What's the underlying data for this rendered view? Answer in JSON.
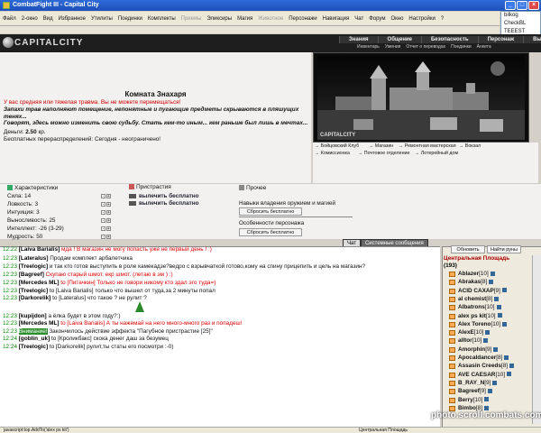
{
  "window": {
    "title": "CombatFight III - Capital City"
  },
  "menu": [
    "Файл",
    "2-окно",
    "Вид",
    "Избранное",
    "Утилиты",
    "Поединки",
    "Комплекты",
    "Приемы",
    "Эликсиры",
    "Магия",
    "Животное",
    "Персонажи",
    "Навигация",
    "Чат",
    "Форум",
    "Окно",
    "Настройки",
    "?"
  ],
  "menu_disabled": [
    "Приемы",
    "Животное"
  ],
  "side_list": [
    "bilkog",
    "CheckBL",
    "TEEEST"
  ],
  "logo": {
    "text": "CAPITALCITY"
  },
  "top_tabs": [
    "Знания",
    "Общение",
    "Безопасность",
    "Персонаж",
    "Выход"
  ],
  "sub_tabs": [
    "Инвентарь",
    "Умения",
    "Отчет о переводах",
    "Поединки",
    "Анкета"
  ],
  "room": {
    "title": "Комната Знахаря",
    "warning": "У вас средняя или тяжелая травма. Вы не можете перемещаться!",
    "desc1": "Запахи трав наполняют помещение, непонятные и пугающие предметы скрываются в пляшущих тенях...",
    "desc2": "Говорят, здесь можно изменить свою судьбу. Стать кем-то иным... кем раньше был лишь в мечтах...",
    "money_label": "Деньги:",
    "money_value": "2.50",
    "money_unit": "кр.",
    "redist": "Бесплатных перераспределений: Сегодня - неограничено!"
  },
  "picture_label": "CAPITALCITY",
  "locations": [
    "Бойцовский Клуб",
    "Магазин",
    "Ремонтная мастерская",
    "Вокзал",
    "Комиссионка",
    "Почтовое отделение",
    "Лотерейный дом"
  ],
  "sections": {
    "stats": "Характеристики",
    "addictions": "Пристрастия",
    "other": "Прочее"
  },
  "stats": [
    {
      "label": "Сила: 14"
    },
    {
      "label": "Ловкость: 3"
    },
    {
      "label": "Интуиция: 3"
    },
    {
      "label": "Выносливость: 25"
    },
    {
      "label": "Интеллект: -26 (3-29)"
    },
    {
      "label": "Мудрость: 50"
    }
  ],
  "addictions": [
    "вылечить бесплатно",
    "вылечить бесплатно"
  ],
  "other": {
    "weapon_skills": "Навыки владения оружием и магией",
    "reset1": "Сбросить бесплатно",
    "features": "Особенности персонажа",
    "reset2": "Сбросить бесплатно"
  },
  "chat_tabs": [
    "Чат",
    "Системные сообщения"
  ],
  "chat": [
    {
      "time": "12:22",
      "name": "[Laiva Barialis]",
      "text": " мда ! В магазин не могу попасть уже не первый день ! :)",
      "red": true
    },
    {
      "time": "12:23",
      "name": "[Lateralus]",
      "text": " Продам комплект арбалетчика",
      "red": false
    },
    {
      "time": "12:23",
      "name": "[Treelogic]",
      "text": " и так кто готов выступить в роле камекадзе?ведро с взрывчаткой готово,кому на спину прицепить и цель на магазин?",
      "red": false
    },
    {
      "time": "12:23",
      "name": "[Bagreef]",
      "text": " Скупаю старый шмот, екр шмот. (летаю в эм ) :)",
      "red": true
    },
    {
      "time": "12:23",
      "name": "[Mercedes ML]",
      "text": " to [Питачкин] Только не говори никому кто здал эго туда=)",
      "red": true
    },
    {
      "time": "12:23",
      "name": "[Treelogic]",
      "text": " to [Laiva Barialis] только что вышел от туда,за 2 минуты попал",
      "red": false
    },
    {
      "time": "12:23",
      "name": "[Darkorelik]",
      "text": " to [Lateralus] что такое ? не рулит ?",
      "red": false
    },
    {
      "time": "12:23",
      "name": "[kupijdon]",
      "text": " а ёлка будет в этом году?:)",
      "red": false
    },
    {
      "time": "12:23",
      "name": "[Mercedes ML]",
      "text": " to [Laiva Barialis] А ты нажемай на него много-много раз и попадеш!",
      "red": true
    },
    {
      "time": "12:23",
      "name": "",
      "text": "Закончилось действие эффекта \"Пагубное пристрастие [25]\"",
      "system": "Внимание!",
      "red": false
    },
    {
      "time": "12:24",
      "name": "[goblin_uk]",
      "text": " to [Кроликбакс] скока денег даш за безумец",
      "red": false
    },
    {
      "time": "12:24",
      "name": "[Treelogic]",
      "text": " to [Darkorelik] рулит,ты статы его посмотри :-0)",
      "red": false
    }
  ],
  "userlist": {
    "refresh": "Обновить",
    "find": "Найти руны",
    "location": "Центральная Площадь",
    "count": "(193)",
    "users": [
      {
        "name": "Ablazer",
        "lv": "[10]"
      },
      {
        "name": "Abrakas",
        "lv": "[8]"
      },
      {
        "name": "ACID CAXAP",
        "lv": "[9]"
      },
      {
        "name": "al chemist",
        "lv": "[8]"
      },
      {
        "name": "Albatrons",
        "lv": "[10]"
      },
      {
        "name": "alex ps kit",
        "lv": "[10]"
      },
      {
        "name": "Alex Toreno",
        "lv": "[10]"
      },
      {
        "name": "AlexE",
        "lv": "[10]"
      },
      {
        "name": "alltor",
        "lv": "[10]"
      },
      {
        "name": "Amorphin",
        "lv": "[9]"
      },
      {
        "name": "Apocaldancer",
        "lv": "[8]"
      },
      {
        "name": "Assasin Creeds",
        "lv": "[8]"
      },
      {
        "name": "AVE CAESAR",
        "lv": "[10]"
      },
      {
        "name": "B_RAY_N",
        "lv": "[9]"
      },
      {
        "name": "Bagreef",
        "lv": "[9]"
      },
      {
        "name": "Berry",
        "lv": "[10]"
      },
      {
        "name": "Bimbo",
        "lv": "[8]"
      }
    ]
  },
  "statusbar": {
    "url": "javascript:top.AddTo('alex ps kit')",
    "location": "Центральная Площадь"
  },
  "watermark": "photo.scroll.combats.com"
}
